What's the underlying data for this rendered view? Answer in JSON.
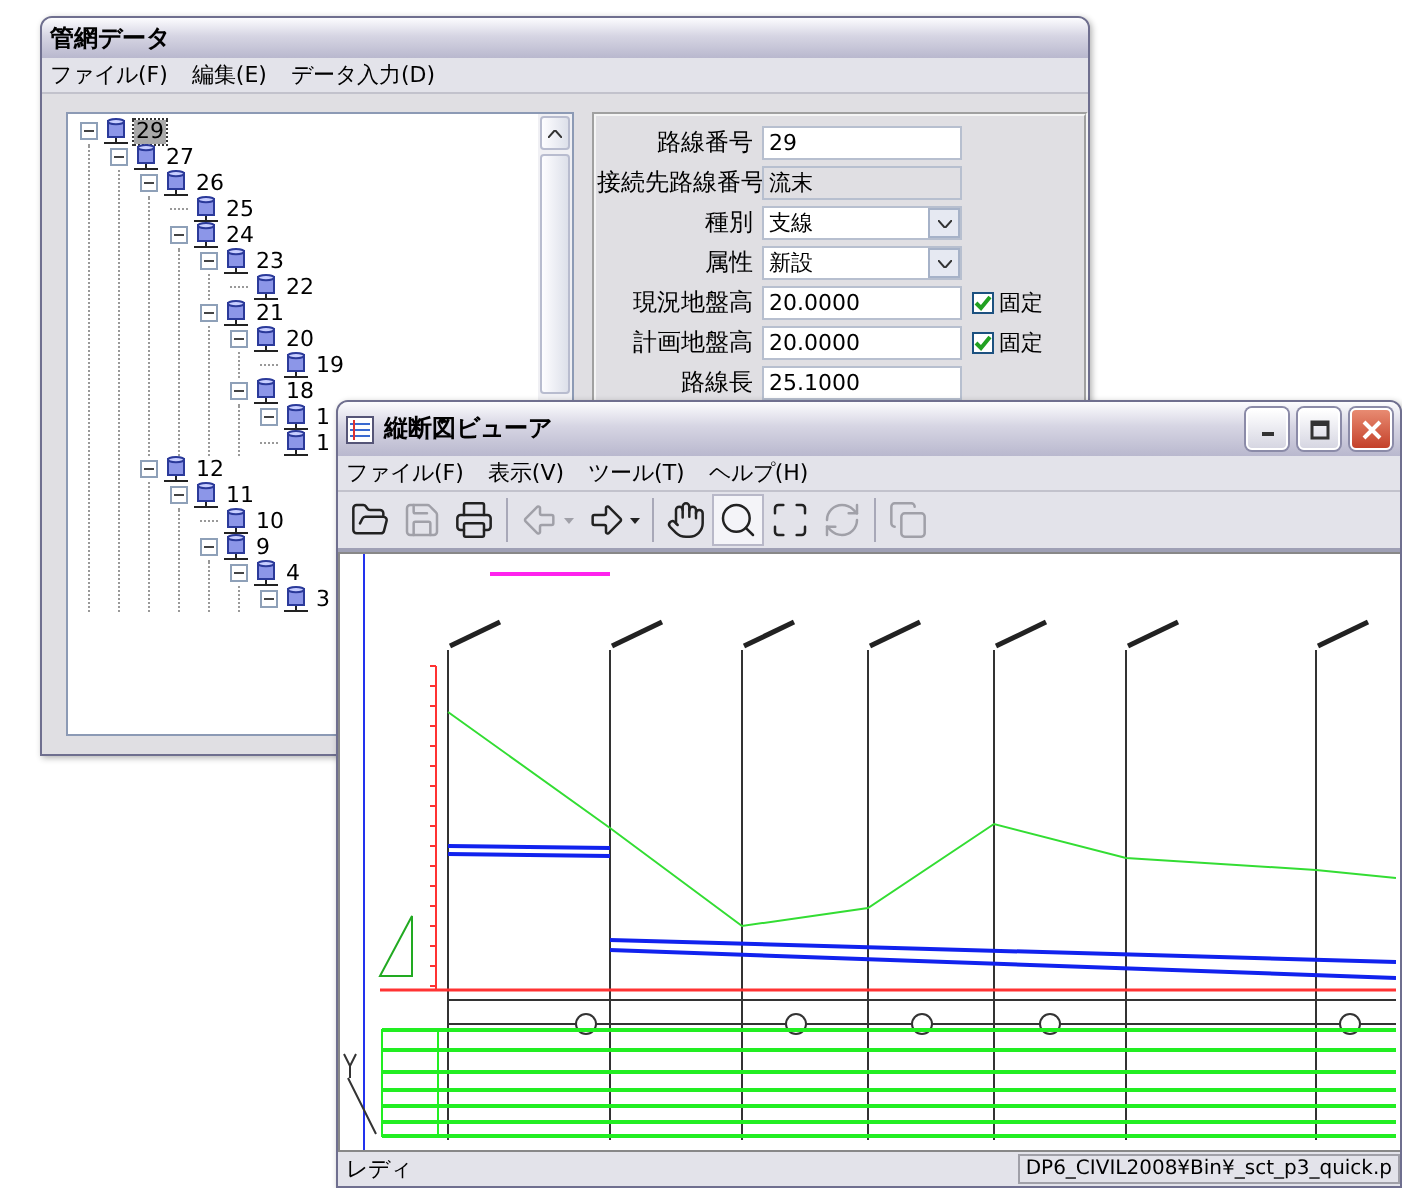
{
  "back_window": {
    "title": "管網データ",
    "menu": [
      "ファイル(F)",
      "編集(E)",
      "データ入力(D)"
    ],
    "tree": [
      {
        "label": "29",
        "selected": true,
        "expanded": true,
        "children": [
          {
            "label": "27",
            "selected": false,
            "expanded": true,
            "children": [
              {
                "label": "26",
                "selected": false,
                "expanded": true,
                "children": [
                  {
                    "label": "25",
                    "selected": false
                  },
                  {
                    "label": "24",
                    "selected": false,
                    "expanded": true,
                    "children": [
                      {
                        "label": "23",
                        "selected": false,
                        "expanded": true,
                        "children": [
                          {
                            "label": "22",
                            "selected": false
                          }
                        ]
                      },
                      {
                        "label": "21",
                        "selected": false,
                        "expanded": true,
                        "children": [
                          {
                            "label": "20",
                            "selected": false,
                            "expanded": true,
                            "children": [
                              {
                                "label": "19",
                                "selected": false
                              }
                            ]
                          },
                          {
                            "label": "18",
                            "selected": false,
                            "expanded": true,
                            "children": [
                              {
                                "label": "1",
                                "selected": false,
                                "expanded": true
                              },
                              {
                                "label": "1",
                                "selected": false
                              }
                            ]
                          }
                        ]
                      }
                    ]
                  }
                ]
              },
              {
                "label": "12",
                "selected": false,
                "expanded": true,
                "children": [
                  {
                    "label": "11",
                    "selected": false,
                    "expanded": true,
                    "children": [
                      {
                        "label": "10",
                        "selected": false
                      },
                      {
                        "label": "9",
                        "selected": false,
                        "expanded": true,
                        "children": [
                          {
                            "label": "4",
                            "selected": false,
                            "expanded": true,
                            "children": [
                              {
                                "label": "3",
                                "selected": false,
                                "expanded": true
                              }
                            ]
                          }
                        ]
                      }
                    ]
                  }
                ]
              }
            ]
          }
        ]
      }
    ],
    "form": [
      {
        "kind": "text",
        "label": "路線番号",
        "value": "29"
      },
      {
        "kind": "readonly",
        "label": "接続先路線番号",
        "value": "流末"
      },
      {
        "kind": "select",
        "label": "種別",
        "value": "支線"
      },
      {
        "kind": "select",
        "label": "属性",
        "value": "新設"
      },
      {
        "kind": "text",
        "label": "現況地盤高",
        "value": "20.0000",
        "fixed": {
          "label": "固定",
          "checked": true
        }
      },
      {
        "kind": "text",
        "label": "計画地盤高",
        "value": "20.0000",
        "fixed": {
          "label": "固定",
          "checked": true
        }
      },
      {
        "kind": "text",
        "label": "路線長",
        "value": "25.1000"
      }
    ]
  },
  "front_window": {
    "title": "縦断図ビューア",
    "menu": [
      "ファイル(F)",
      "表示(V)",
      "ツール(T)",
      "ヘルプ(H)"
    ],
    "toolbar": [
      [
        {
          "kind": "open",
          "disabled": false,
          "pressed": false
        },
        {
          "kind": "save",
          "disabled": true,
          "pressed": false
        },
        {
          "kind": "print",
          "disabled": false,
          "pressed": false
        }
      ],
      [
        {
          "kind": "back",
          "disabled": true,
          "pressed": false,
          "dropdown": true
        },
        {
          "kind": "forward",
          "disabled": false,
          "pressed": false,
          "dropdown": true
        }
      ],
      [
        {
          "kind": "pan",
          "disabled": false,
          "pressed": false
        },
        {
          "kind": "zoom",
          "disabled": false,
          "pressed": true
        },
        {
          "kind": "fit",
          "disabled": false,
          "pressed": false
        },
        {
          "kind": "refresh",
          "disabled": true,
          "pressed": false
        }
      ],
      [
        {
          "kind": "windows",
          "disabled": true,
          "pressed": false
        }
      ]
    ],
    "status_bar": {
      "message": "レディ",
      "path": "DP6_CIVIL2008¥Bin¥_sct_p3_quick.p"
    }
  }
}
